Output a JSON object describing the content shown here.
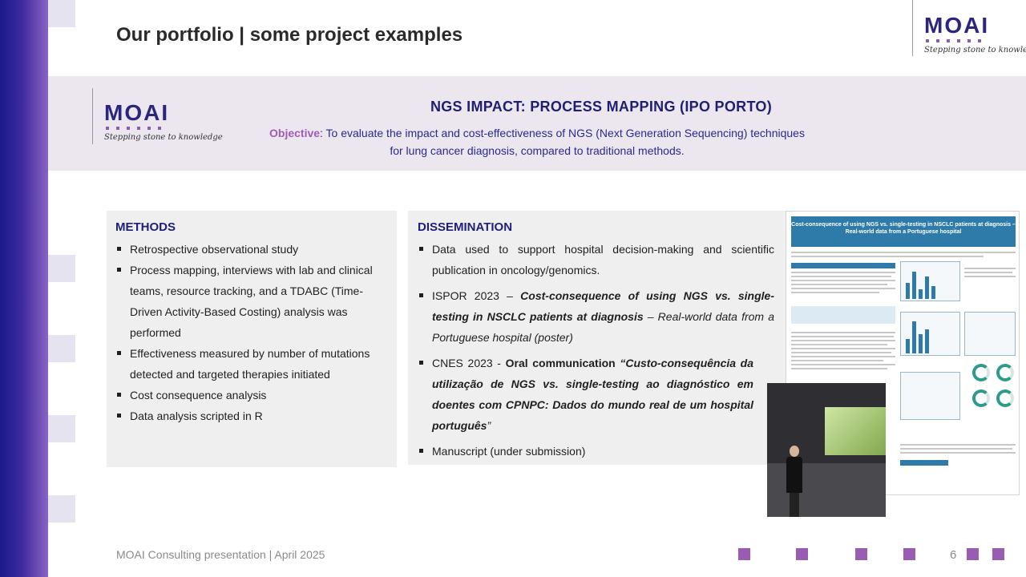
{
  "slide": {
    "title": "Our portfolio | some project examples",
    "page_number": "6",
    "footer": "MOAI Consulting presentation | April 2025"
  },
  "logo": {
    "word": "MOAI",
    "tagline": "Stepping stone to knowledge"
  },
  "banner": {
    "title": "NGS IMPACT: PROCESS MAPPING (IPO PORTO)",
    "objective_label": "Objective",
    "objective_text": ": To evaluate the impact and cost-effectiveness of NGS (Next Generation Sequencing) techniques for lung cancer diagnosis, compared to traditional methods."
  },
  "methods": {
    "heading": "METHODS",
    "items": [
      "Retrospective observational study",
      "Process mapping, interviews with lab and clinical teams, resource tracking, and a TDABC (Time-Driven Activity-Based Costing) analysis was performed",
      "Effectiveness measured by number of mutations detected and targeted therapies initiated",
      "Cost consequence analysis",
      "Data analysis scripted in R"
    ]
  },
  "dissemination": {
    "heading": "DISSEMINATION",
    "item1": "Data used to support hospital decision-making and scientific publication in oncology/genomics.",
    "item2": {
      "prefix": "ISPOR 2023 – ",
      "title": "Cost-consequence of using NGS vs. single-testing in NSCLC patients at diagnosis",
      "suffix": " – Real-world data from a Portuguese hospital (poster)"
    },
    "item3": {
      "prefix": "CNES 2023 - ",
      "bold": "Oral communication",
      "title": " “Custo-consequência da utilização de NGS vs. single-testing ao diagnóstico em doentes com CPNPC: Dados do mundo real de um hospital português",
      "suffix": "”"
    },
    "item4": "Manuscript (under submission)"
  },
  "poster": {
    "title": "Cost-consequence of using NGS vs. single-testing in NSCLC patients at diagnosis – Real-world data from a Portuguese hospital"
  }
}
